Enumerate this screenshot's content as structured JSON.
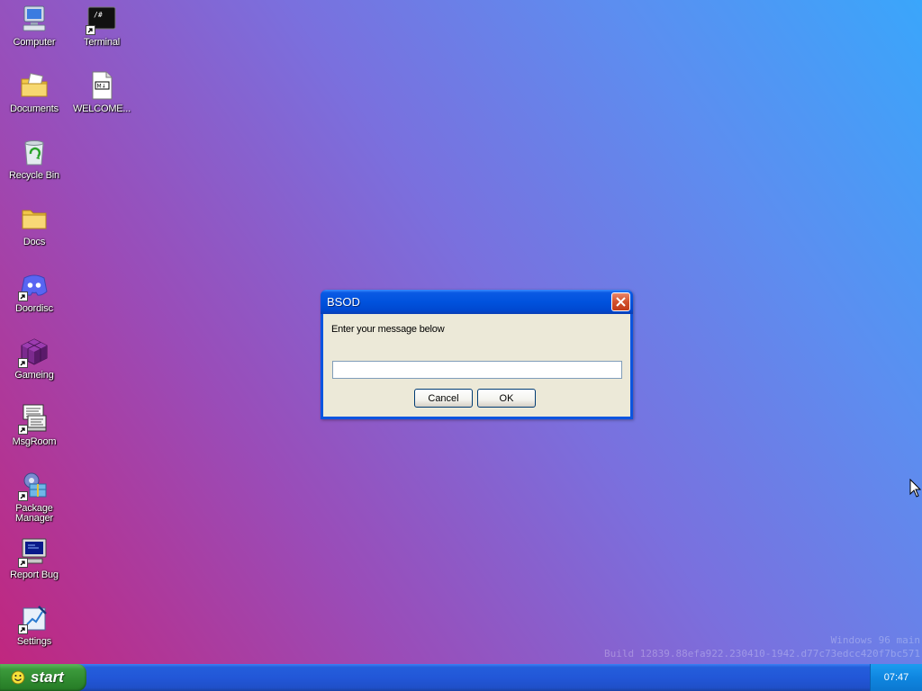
{
  "desktop": {
    "icons": [
      {
        "label": "Computer",
        "icon": "computer-icon",
        "shortcut": false
      },
      {
        "label": "Terminal",
        "icon": "terminal-icon",
        "shortcut": true
      },
      {
        "label": "Documents",
        "icon": "documents-icon",
        "shortcut": false
      },
      {
        "label": "WELCOME...",
        "icon": "markdown-file-icon",
        "shortcut": false
      },
      {
        "label": "Recycle Bin",
        "icon": "recycle-bin-icon",
        "shortcut": false
      },
      {
        "label": "Docs",
        "icon": "folder-icon",
        "shortcut": false
      },
      {
        "label": "Doordisc",
        "icon": "discord-icon",
        "shortcut": true
      },
      {
        "label": "Gameing",
        "icon": "game-cube-icon",
        "shortcut": true
      },
      {
        "label": "MsgRoom",
        "icon": "chat-room-icon",
        "shortcut": true
      },
      {
        "label": "Package Manager",
        "icon": "package-manager-icon",
        "shortcut": true
      },
      {
        "label": "Report Bug",
        "icon": "report-bug-icon",
        "shortcut": true
      },
      {
        "label": "Settings",
        "icon": "settings-icon",
        "shortcut": true
      }
    ]
  },
  "dialog": {
    "title": "BSOD",
    "prompt": "Enter your message below",
    "input_value": "",
    "cancel_label": "Cancel",
    "ok_label": "OK"
  },
  "watermark": {
    "line1": "Windows 96 main",
    "line2": "Build 12839.88efa922.230410-1942.d77c73edcc420f7bc571"
  },
  "taskbar": {
    "start_label": "start",
    "clock": "07:47"
  },
  "colors": {
    "titlebar": "#0052dd",
    "start_button": "#3c9a3c",
    "taskbar": "#245edb",
    "tray": "#0f86e0"
  }
}
